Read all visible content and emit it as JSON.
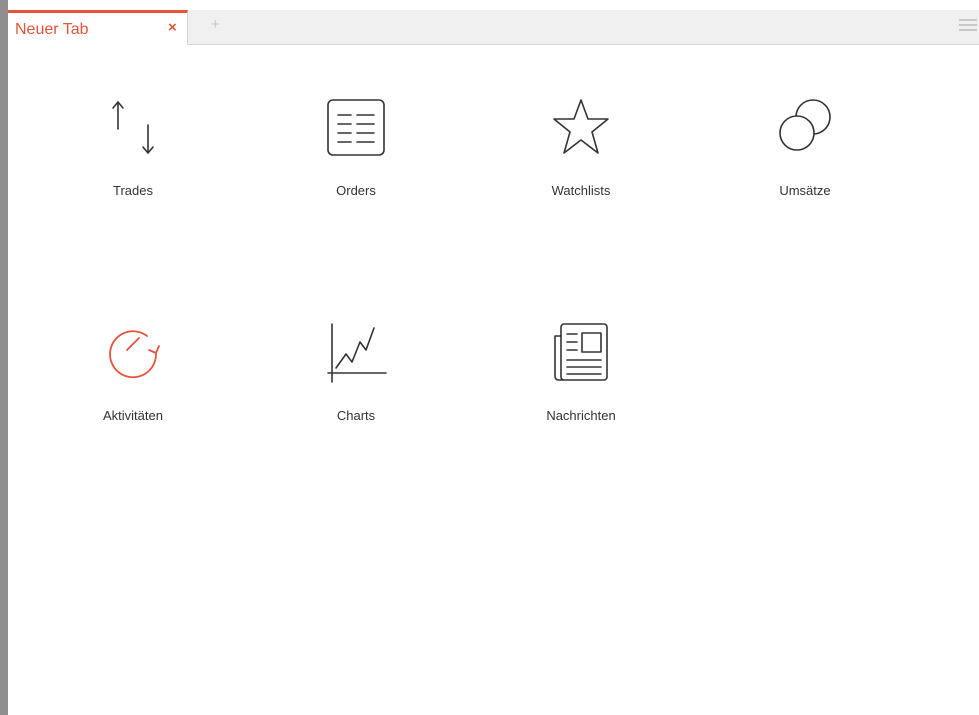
{
  "tab": {
    "label": "Neuer Tab",
    "close_glyph": "×",
    "new_tab_glyph": "+"
  },
  "tiles": [
    {
      "label": "Trades",
      "icon": "arrows-up-down-icon"
    },
    {
      "label": "Orders",
      "icon": "list-document-icon"
    },
    {
      "label": "Watchlists",
      "icon": "star-icon"
    },
    {
      "label": "Umsätze",
      "icon": "overlapping-circles-icon"
    },
    {
      "label": "Aktivitäten",
      "icon": "gauge-icon"
    },
    {
      "label": "Charts",
      "icon": "line-chart-icon"
    },
    {
      "label": "Nachrichten",
      "icon": "newspaper-icon"
    }
  ],
  "colors": {
    "accent": "#e8543b",
    "icon": "#333333",
    "tabbar_bg": "#f0f0f0"
  }
}
